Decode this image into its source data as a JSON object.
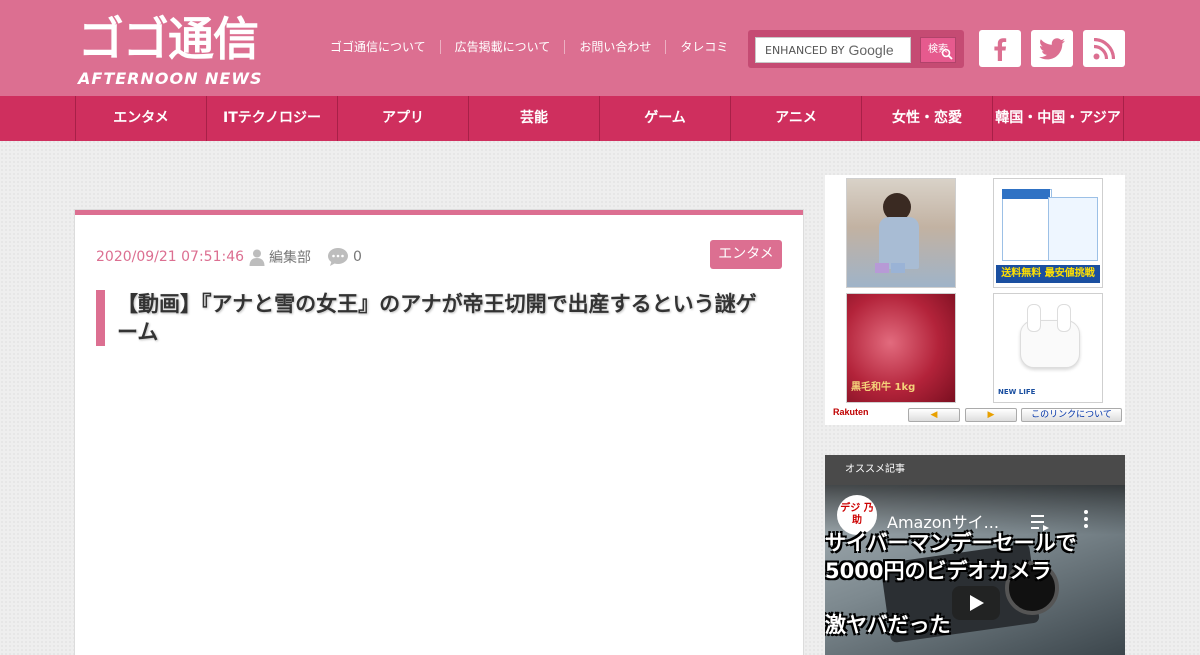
{
  "header": {
    "logo_main": "ゴゴ通信",
    "logo_sub": "AFTERNOON NEWS",
    "links": [
      "ゴゴ通信について",
      "広告掲載について",
      "お問い合わせ",
      "タレコミ"
    ],
    "search": {
      "label": "ENHANCED BY",
      "brand": "Google",
      "button": "検索"
    },
    "social": [
      "facebook-icon",
      "twitter-icon",
      "rss-icon"
    ]
  },
  "nav": {
    "items": [
      "エンタメ",
      "ITテクノロジー",
      "アプリ",
      "芸能",
      "ゲーム",
      "アニメ",
      "女性・恋愛",
      "韓国・中国・アジア"
    ]
  },
  "article": {
    "date": "2020/09/21 07:51:46",
    "author": "編集部",
    "comments": "0",
    "category": "エンタメ",
    "title": "【動画】『アナと雪の女王』のアナが帝王切開で出産するという謎ゲーム"
  },
  "ad": {
    "items": [
      {
        "caption": "",
        "color": "#c9b8a8"
      },
      {
        "caption": "送料無料 最安値挑戦",
        "color": "#e8f0fa"
      },
      {
        "caption": "黒毛和牛 1kg",
        "color": "#b0172a"
      },
      {
        "caption": "NEW LIFE",
        "color": "#f5f5f5"
      }
    ],
    "brand": "Rakuten",
    "prev": "◀",
    "next": "▶",
    "about": "このリンクについて"
  },
  "sidebar": {
    "recommend_title": "オススメ記事",
    "video": {
      "channel": "デジ 乃助",
      "title": "Amazonサイ...",
      "caption_line1": "サイバーマンデーセールで",
      "caption_line2": "5000円のビデオカメラ",
      "caption_line3": "激ヤバだった"
    }
  },
  "colors": {
    "header_bg": "#dc6f91",
    "nav_bg": "#cf2f5e",
    "accent": "#dc6f91"
  }
}
